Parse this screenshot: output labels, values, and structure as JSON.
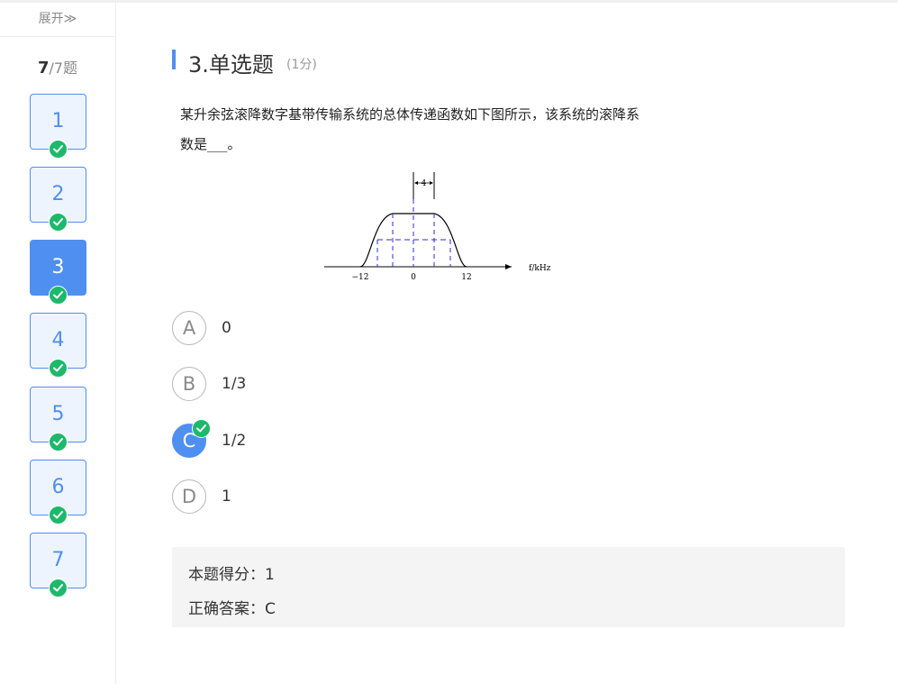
{
  "sidebar": {
    "expand_label": "展开≫",
    "progress_current": "7",
    "progress_total": "/7题",
    "items": [
      {
        "label": "1",
        "state": "answered"
      },
      {
        "label": "2",
        "state": "answered"
      },
      {
        "label": "3",
        "state": "current"
      },
      {
        "label": "4",
        "state": "answered"
      },
      {
        "label": "5",
        "state": "answered"
      },
      {
        "label": "6",
        "state": "answered"
      },
      {
        "label": "7",
        "state": "answered"
      }
    ]
  },
  "question": {
    "heading": "3.单选题",
    "points": "(1分)",
    "text_line1": "某升余弦滚降数字基带传输系统的总体传递函数如下图所示，该系统的滚降系",
    "text_line2": "数是___。",
    "figure": {
      "axis_label": "f/kHz",
      "ticks": [
        "−12",
        "0",
        "12"
      ],
      "width_label": "4"
    },
    "options": [
      {
        "letter": "A",
        "text": "0",
        "selected": false
      },
      {
        "letter": "B",
        "text": "1/3",
        "selected": false
      },
      {
        "letter": "C",
        "text": "1/2",
        "selected": true
      },
      {
        "letter": "D",
        "text": "1",
        "selected": false
      }
    ]
  },
  "result": {
    "score_line": "本题得分：1",
    "answer_line": "正确答案：C"
  },
  "colors": {
    "accent": "#4f8ff0",
    "check": "#1db96b",
    "dashed": "#2b2bd6"
  }
}
